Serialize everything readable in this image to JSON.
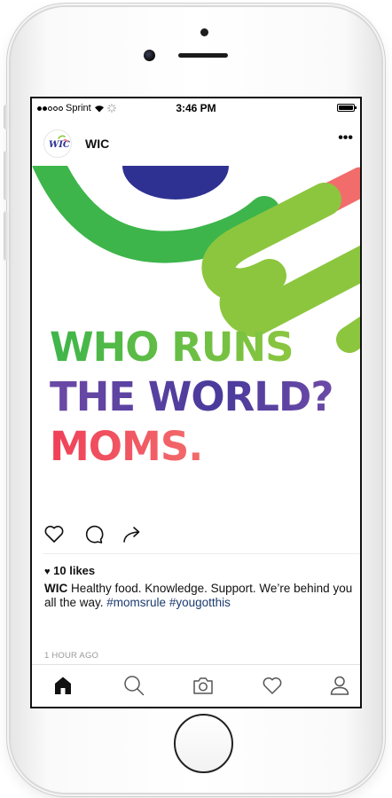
{
  "status_bar": {
    "carrier": "Sprint",
    "time": "3:46 PM"
  },
  "post": {
    "username": "WIC",
    "avatar_text": "WIC",
    "more_label": "•••",
    "headline": {
      "line1": "WHO RUNS",
      "line2": "THE WORLD?",
      "line3": "MOMS."
    },
    "likes": "10 likes",
    "caption": {
      "author": "WIC",
      "text": " Healthy food. Knowledge. Support. We’re behind you all the way. ",
      "hashtag1": "#momsrule",
      "hashtag2": "#yougotthis"
    },
    "time_ago": "1 HOUR AGO"
  },
  "icons": {
    "actions": [
      "heart-icon",
      "comment-icon",
      "share-icon"
    ],
    "tabs": [
      "home-icon",
      "search-icon",
      "camera-icon",
      "activity-heart-icon",
      "profile-icon"
    ]
  },
  "colors": {
    "green": "#3DB54A",
    "lime": "#8CC63F",
    "purple": "#6C4AA6",
    "navy": "#2E3192",
    "coral": "#F26C6C",
    "red": "#EF4058",
    "hashtag": "#1B3A6E"
  }
}
